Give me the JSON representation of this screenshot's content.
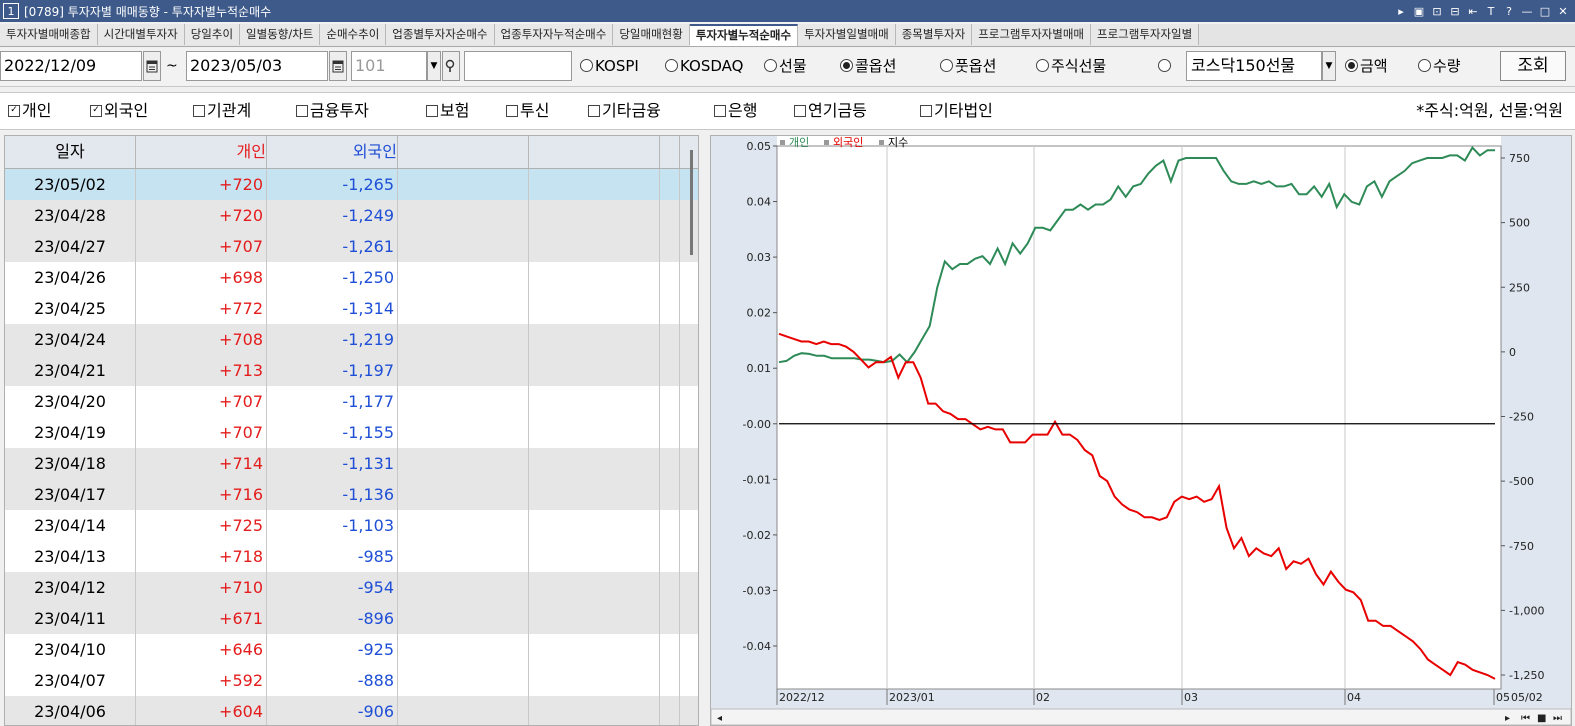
{
  "window": {
    "number": "1",
    "title": "[0789] 투자자별 매매동향 - 투자자별누적순매수",
    "controls": [
      "▸",
      "▣",
      "⊡",
      "⊟",
      "⇤",
      "T",
      "?",
      "—",
      "□",
      "✕"
    ]
  },
  "tabs": [
    "투자자별매매종합",
    "시간대별투자자",
    "당일추이",
    "일별동향/차트",
    "순매수추이",
    "업종별투자자순매수",
    "업종투자자누적순매수",
    "당일매매현황",
    "투자자별누적순매수",
    "투자자별일별매매",
    "종목별투자자",
    "프로그램투자자별매매",
    "프로그램투자자일별"
  ],
  "active_tab": 8,
  "toolbar": {
    "date_from": "2022/12/09",
    "tilde": "~",
    "date_to": "2023/05/03",
    "code": "101",
    "market_radios": [
      {
        "label": "KOSPI",
        "on": false
      },
      {
        "label": "KOSDAQ",
        "on": false
      },
      {
        "label": "선물",
        "on": false
      },
      {
        "label": "콜옵션",
        "on": true
      },
      {
        "label": "풋옵션",
        "on": false
      },
      {
        "label": "주식선물",
        "on": false
      },
      {
        "label": "",
        "on": false
      }
    ],
    "product_select": "코스닥150선물",
    "amount_radios": [
      {
        "label": "금액",
        "on": true
      },
      {
        "label": "수량",
        "on": false
      }
    ],
    "query_button": "조회"
  },
  "investors": [
    {
      "label": "개인",
      "checked": true
    },
    {
      "label": "외국인",
      "checked": true
    },
    {
      "label": "기관계",
      "checked": false
    },
    {
      "label": "금융투자",
      "checked": false
    },
    {
      "label": "보험",
      "checked": false
    },
    {
      "label": "투신",
      "checked": false
    },
    {
      "label": "기타금융",
      "checked": false
    },
    {
      "label": "은행",
      "checked": false
    },
    {
      "label": "연기금등",
      "checked": false
    },
    {
      "label": "기타법인",
      "checked": false
    }
  ],
  "unit_note": "*주식:억원, 선물:억원",
  "table": {
    "headers": [
      "일자",
      "개인",
      "외국인",
      "",
      "",
      ""
    ],
    "rows": [
      [
        "23/05/02",
        "+720",
        "-1,265"
      ],
      [
        "23/04/28",
        "+720",
        "-1,249"
      ],
      [
        "23/04/27",
        "+707",
        "-1,261"
      ],
      [
        "23/04/26",
        "+698",
        "-1,250"
      ],
      [
        "23/04/25",
        "+772",
        "-1,314"
      ],
      [
        "23/04/24",
        "+708",
        "-1,219"
      ],
      [
        "23/04/21",
        "+713",
        "-1,197"
      ],
      [
        "23/04/20",
        "+707",
        "-1,177"
      ],
      [
        "23/04/19",
        "+707",
        "-1,155"
      ],
      [
        "23/04/18",
        "+714",
        "-1,131"
      ],
      [
        "23/04/17",
        "+716",
        "-1,136"
      ],
      [
        "23/04/14",
        "+725",
        "-1,103"
      ],
      [
        "23/04/13",
        "+718",
        "-985"
      ],
      [
        "23/04/12",
        "+710",
        "-954"
      ],
      [
        "23/04/11",
        "+671",
        "-896"
      ],
      [
        "23/04/10",
        "+646",
        "-925"
      ],
      [
        "23/04/07",
        "+592",
        "-888"
      ],
      [
        "23/04/06",
        "+604",
        "-906"
      ]
    ]
  },
  "chart_data": {
    "type": "line",
    "legend": [
      {
        "name": "개인",
        "color": "#2e8b57"
      },
      {
        "name": "외국인",
        "color": "#e80000"
      },
      {
        "name": "지수",
        "color": "#000000"
      }
    ],
    "left_axis": {
      "ticks": [
        "0.05",
        "0.04",
        "0.03",
        "0.02",
        "0.01",
        "-0.00",
        "-0.01",
        "-0.02",
        "-0.03",
        "-0.04"
      ],
      "range": [
        -0.045,
        0.05
      ]
    },
    "right_axis": {
      "ticks": [
        "750",
        "500",
        "250",
        "0",
        "-250",
        "-500",
        "-750",
        "-1,000",
        "-1,250"
      ],
      "range": [
        -1250,
        750
      ]
    },
    "x_labels": [
      "2022/12",
      "2023/01",
      "02",
      "03",
      "04",
      "05",
      "05/02"
    ],
    "series": [
      {
        "name": "개인",
        "color": "#2e8b57",
        "values": [
          -40,
          -35,
          -15,
          -5,
          -8,
          -15,
          -15,
          -25,
          -25,
          -25,
          -25,
          -30,
          -30,
          -35,
          -40,
          -35,
          -10,
          -40,
          0,
          50,
          100,
          250,
          350,
          320,
          340,
          340,
          360,
          370,
          340,
          400,
          340,
          420,
          380,
          420,
          480,
          480,
          470,
          510,
          550,
          550,
          570,
          550,
          570,
          570,
          590,
          640,
          600,
          640,
          650,
          690,
          720,
          740,
          660,
          740,
          750,
          750,
          750,
          750,
          750,
          700,
          660,
          650,
          650,
          660,
          650,
          660,
          640,
          640,
          650,
          610,
          610,
          640,
          600,
          650,
          560,
          610,
          580,
          570,
          640,
          660,
          600,
          660,
          680,
          700,
          730,
          740,
          750,
          750,
          750,
          760,
          760,
          740,
          790,
          760,
          780,
          780
        ]
      },
      {
        "name": "외국인",
        "color": "#e80000",
        "values": [
          70,
          60,
          50,
          40,
          40,
          30,
          40,
          30,
          30,
          20,
          0,
          -30,
          -60,
          -40,
          -40,
          -20,
          -100,
          -40,
          -40,
          -100,
          -200,
          -200,
          -230,
          -240,
          -260,
          -260,
          -280,
          -300,
          -290,
          -300,
          -300,
          -350,
          -350,
          -350,
          -320,
          -320,
          -320,
          -270,
          -320,
          -320,
          -340,
          -380,
          -400,
          -480,
          -500,
          -560,
          -590,
          -610,
          -620,
          -640,
          -640,
          -650,
          -640,
          -580,
          -560,
          -570,
          -560,
          -580,
          -570,
          -520,
          -680,
          -760,
          -720,
          -790,
          -760,
          -780,
          -790,
          -760,
          -840,
          -810,
          -820,
          -800,
          -860,
          -900,
          -850,
          -890,
          -920,
          -930,
          -960,
          -1040,
          -1040,
          -1060,
          -1060,
          -1080,
          -1100,
          -1120,
          -1150,
          -1190,
          -1210,
          -1230,
          -1250,
          -1200,
          -1210,
          -1230,
          -1240,
          -1250,
          -1265
        ]
      },
      {
        "name": "지수",
        "color": "#000000",
        "values": [
          0
        ]
      }
    ]
  }
}
